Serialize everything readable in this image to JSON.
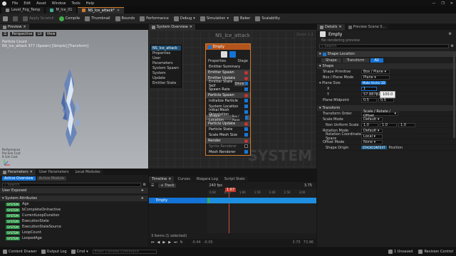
{
  "menubar": {
    "items": [
      "File",
      "Edit",
      "Asset",
      "Window",
      "Tools",
      "Help"
    ],
    "window_controls": [
      "—",
      "❐",
      "✕"
    ]
  },
  "tabs": [
    {
      "label": "Level_Fog_Temp",
      "active": false
    },
    {
      "label": "M_Ice_01",
      "active": false
    },
    {
      "label": "NS_Ice_attack*",
      "active": true
    }
  ],
  "toolbar": {
    "apply_scratch": "Apply Scratch",
    "compile": "Compile",
    "thumbnail": "Thumbnail",
    "bounds": "Bounds",
    "performance": "Performance",
    "debug": "Debug",
    "simulation": "Simulation",
    "baker": "Baker",
    "scalability": "Scalability"
  },
  "preview": {
    "tab": "Preview",
    "perspective": "Perspective",
    "lit": "Lit",
    "view": "View",
    "overlay_line1": "Particle Count",
    "overlay_line2": "NS_Ice_attack 377 (Spawn) [Simple] [Transform]",
    "bottom_info": "Performance\nPre-Sim Cost\nIt Sim Cost"
  },
  "system_overview": {
    "tab": "System Overview",
    "title": "NS_Ice_attack",
    "watermark": "SYSTEM",
    "zoom": "Zoom 1:1",
    "system_node": {
      "title": "NS_Ice_attack",
      "items": [
        "Properties",
        "User Parameters",
        "System Spawn",
        "System Update",
        "Emitter State"
      ]
    },
    "emitter_node": {
      "title": "Empty",
      "properties": "Properties",
      "stage": "Stage",
      "summary": "Emitter Summary",
      "sections": [
        {
          "label": "Emitter Spawn",
          "items": []
        },
        {
          "label": "Emitter Update",
          "items": [
            "Emitter State Self",
            "Spawn Rate"
          ]
        },
        {
          "label": "Particle Spawn",
          "items": [
            "Initialize Particle",
            "System Location",
            "Initial Mesh Orientation",
            "Shape Location"
          ]
        },
        {
          "label": "Particle Update",
          "items": [
            "Particle State",
            "Scale Mesh Size"
          ]
        },
        {
          "label": "Render",
          "items": [
            "Sprite Renderer",
            "Mesh Renderer"
          ]
        }
      ],
      "emitter_state_chip": "Self",
      "emitter_state_value": "Once",
      "shape_location_value": "Box / Plane"
    }
  },
  "parameters": {
    "tab": "Parameters",
    "tab2": "User Parameters",
    "tab3": "Local Modules",
    "filter_all": "Active Overview",
    "filter_modules": "Active Module",
    "search_placeholder": "Search",
    "user_exposed": "User Exposed",
    "system_attributes": "System Attributes",
    "attributes": [
      {
        "type": "SYSTEM",
        "name": "Age",
        "tag": ""
      },
      {
        "type": "SYSTEM",
        "name": "bCompleteOnInactive",
        "tag": ""
      },
      {
        "type": "SYSTEM",
        "name": "CurrentLoopDuration",
        "tag": ""
      },
      {
        "type": "SYSTEM",
        "name": "ExecutionState",
        "tag": ""
      },
      {
        "type": "SYSTEM",
        "name": "ExecutionStateSource",
        "tag": ""
      },
      {
        "type": "SYSTEM",
        "name": "LoopCount",
        "tag": ""
      },
      {
        "type": "SYSTEM",
        "name": "LoopedAge",
        "tag": ""
      }
    ]
  },
  "timeline": {
    "tab": "Timeline",
    "tab2": "Curves",
    "tab3": "Niagara Log",
    "tab4": "Script Stats",
    "track_btn": "+ Track",
    "fps": "240 fps",
    "track_name": "Empty",
    "current_time": "1.67",
    "time_start": "0.00",
    "time_end": "3.75",
    "footer_left": "-0.44",
    "footer_mid": "-0.05",
    "footer_right1": "3.75",
    "footer_right2": "73.96",
    "items_selected": "3 items (1 selected)",
    "ruler": [
      "0.00",
      "0.50",
      "1.00",
      "1.50",
      "2.00",
      "2.50",
      "3.00",
      "3.50"
    ]
  },
  "details": {
    "tab": "Details",
    "tab2": "Preview Scene S...",
    "emitter_name": "Empty",
    "sub": "No rendering preview",
    "search_placeholder": "Search",
    "shape_location": "Shape Location",
    "filters": [
      "Shape",
      "Transform",
      "All"
    ],
    "shape_section": "Shape",
    "shape_primitive_label": "Shape Primitive",
    "shape_primitive_value": "Box / Plane",
    "box_plane_mode_label": "Box / Plane Mode",
    "box_plane_mode_value": "Plane",
    "plane_size_label": "Plane Size",
    "plane_size_chip": "Make Vector 2D",
    "x_label": "X",
    "x_value": "1",
    "y_label": "Y",
    "y_value": "57.887817",
    "tooltip": "100.0",
    "plane_midpoint_label": "Plane Midpoint",
    "plane_midpoint_x": "0.5",
    "plane_midpoint_y": "0.5",
    "transform_section": "Transform",
    "transform_order_label": "Transform Order",
    "transform_order_value": "Scale / Rotate / Offset",
    "scale_mode_label": "Scale Mode",
    "scale_mode_value": "Default",
    "non_uniform_label": "Non Uniform Scale",
    "non_uniform_values": [
      "1.0",
      "1.0",
      "1.0"
    ],
    "rotation_mode_label": "Rotation Mode",
    "rotation_mode_value": "Default",
    "rotation_space_label": "Rotation Coordinate Space",
    "rotation_space_value": "Local",
    "offset_mode_label": "Offset Mode",
    "offset_mode_value": "None",
    "shape_origin_label": "Shape Origin",
    "shape_origin_chip": "STACKCONTEXT",
    "shape_origin_value": "Position"
  },
  "statusbar": {
    "content_drawer": "Content Drawer",
    "output_log": "Output Log",
    "cmd": "Cmd",
    "cmd_placeholder": "Enter Console Command",
    "unsaved": "1 Unsaved",
    "revision": "Revision Control"
  },
  "colors": {
    "accent_blue": "#1473d6",
    "track_blue": "#1e8fe0",
    "param_green": "#1f8a3a",
    "header_orange": "#d07a2a",
    "system_header": "#1d4f73"
  }
}
